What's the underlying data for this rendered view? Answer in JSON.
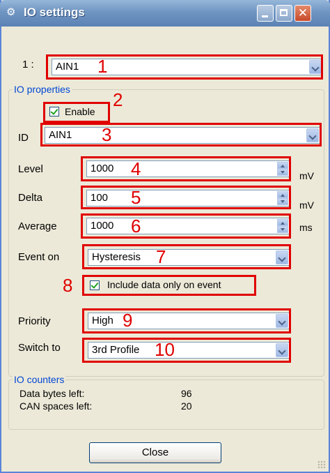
{
  "window": {
    "title": "IO settings"
  },
  "io_select": {
    "index_label": "1  :",
    "value": "AIN1"
  },
  "properties": {
    "group_title": "IO properties",
    "enable_label": "Enable",
    "id_label": "ID",
    "id_value": "AIN1",
    "level_label": "Level",
    "level_value": "1000",
    "level_unit": "mV",
    "delta_label": "Delta",
    "delta_value": "100",
    "delta_unit": "mV",
    "average_label": "Average",
    "average_value": "1000",
    "average_unit": "ms",
    "event_label": "Event on",
    "event_value": "Hysteresis",
    "include_label": "Include data only on event",
    "priority_label": "Priority",
    "priority_value": "High",
    "switch_label": "Switch to",
    "switch_value": "3rd Profile"
  },
  "counters": {
    "group_title": "IO counters",
    "rows": [
      {
        "label": "Data bytes left:",
        "value": "96"
      },
      {
        "label": "CAN spaces left:",
        "value": "20"
      }
    ]
  },
  "annotations": [
    "1",
    "2",
    "3",
    "4",
    "5",
    "6",
    "7",
    "8",
    "9",
    "10"
  ],
  "close_label": "Close",
  "colors": {
    "annotation": "#e00000",
    "titlebar": "#6f95c2",
    "group_title": "#0046d5"
  }
}
